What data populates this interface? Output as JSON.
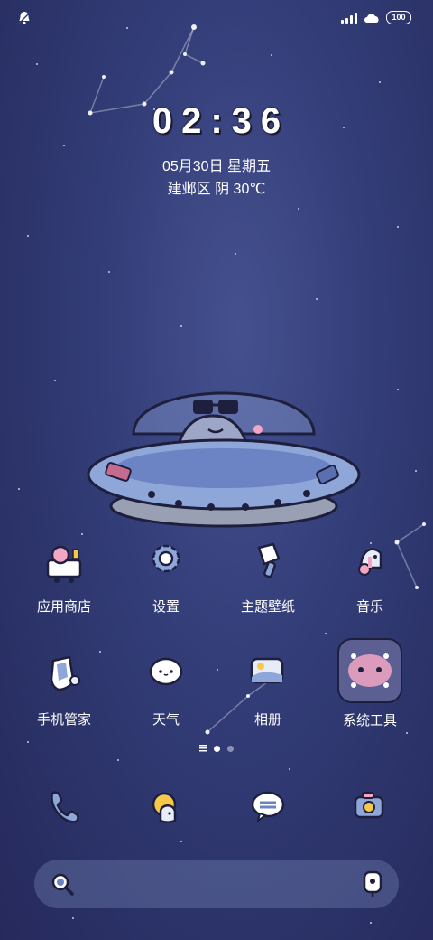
{
  "status_bar": {
    "battery": "100",
    "icons": [
      "notification-bell-icon",
      "signal-icon",
      "hd-cloud-icon",
      "battery-icon"
    ]
  },
  "lockscreen": {
    "time": "02:36",
    "date": "05月30日 星期五",
    "weather": "建邺区 阴 30℃"
  },
  "apps": [
    {
      "label": "应用商店",
      "icon": "app-store-icon"
    },
    {
      "label": "设置",
      "icon": "gear-icon"
    },
    {
      "label": "主题壁纸",
      "icon": "theme-brush-icon"
    },
    {
      "label": "音乐",
      "icon": "music-icon"
    },
    {
      "label": "手机管家",
      "icon": "phone-manager-shield-icon"
    },
    {
      "label": "天气",
      "icon": "weather-cloud-icon"
    },
    {
      "label": "相册",
      "icon": "gallery-icon"
    },
    {
      "label": "系统工具",
      "icon": "system-tools-folder-icon"
    }
  ],
  "page_indicator": {
    "pages": 2,
    "current": 1
  },
  "dock": [
    {
      "icon": "phone-icon"
    },
    {
      "icon": "browser-icon"
    },
    {
      "icon": "messages-icon"
    },
    {
      "icon": "camera-icon"
    }
  ],
  "search": {
    "placeholder": "",
    "icons": [
      "search-icon",
      "voice-assistant-icon"
    ]
  },
  "colors": {
    "background_top": "#45518f",
    "background_bottom": "#26295c",
    "outline": "#1d1f3d",
    "accent_pink": "#f2a6c4",
    "accent_blue": "#8fa6d9"
  }
}
